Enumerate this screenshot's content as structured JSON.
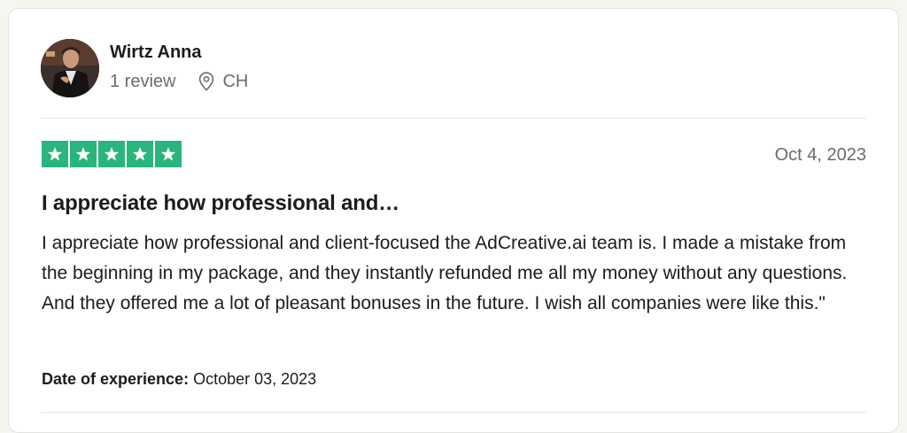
{
  "reviewer": {
    "name": "Wirtz Anna",
    "review_count": "1 review",
    "location": "CH",
    "avatar_icon": "user-avatar-photo",
    "location_icon": "map-pin-icon"
  },
  "review": {
    "rating": 5,
    "rating_max": 5,
    "star_color": "#2ab57d",
    "date": "Oct 4, 2023",
    "title": "I appreciate how professional and…",
    "body": "I appreciate how professional and client-focused the AdCreative.ai team is. I made a mistake from the beginning in my package, and they instantly refunded me all my money without any questions. And they offered me a lot of pleasant bonuses in the future. I wish all companies were like this.\"",
    "experience_label": "Date of experience:",
    "experience_date": "October 03, 2023"
  }
}
